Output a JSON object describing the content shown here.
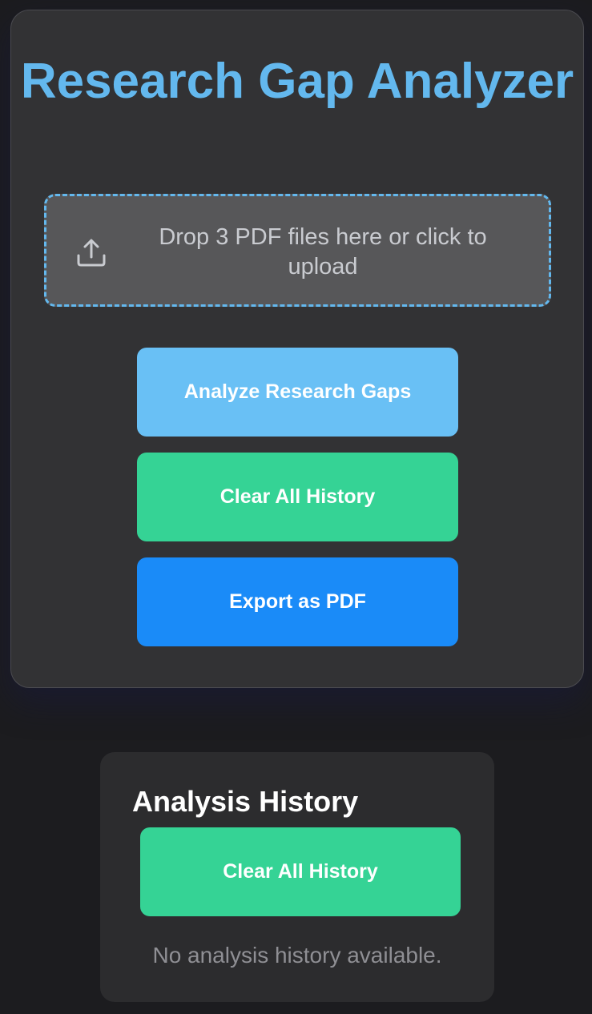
{
  "app": {
    "title": "Research Gap Analyzer"
  },
  "upload": {
    "icon": "upload-icon",
    "text": "Drop 3 PDF files here or click to upload"
  },
  "actions": {
    "analyze_label": "Analyze Research Gaps",
    "clear_label": "Clear All History",
    "export_label": "Export as PDF"
  },
  "history": {
    "title": "Analysis History",
    "clear_label": "Clear All History",
    "empty_message": "No analysis history available."
  },
  "colors": {
    "accent": "#63b8ee",
    "analyze_button": "#69c0f5",
    "clear_button": "#35d395",
    "export_button": "#1a8bf8"
  }
}
